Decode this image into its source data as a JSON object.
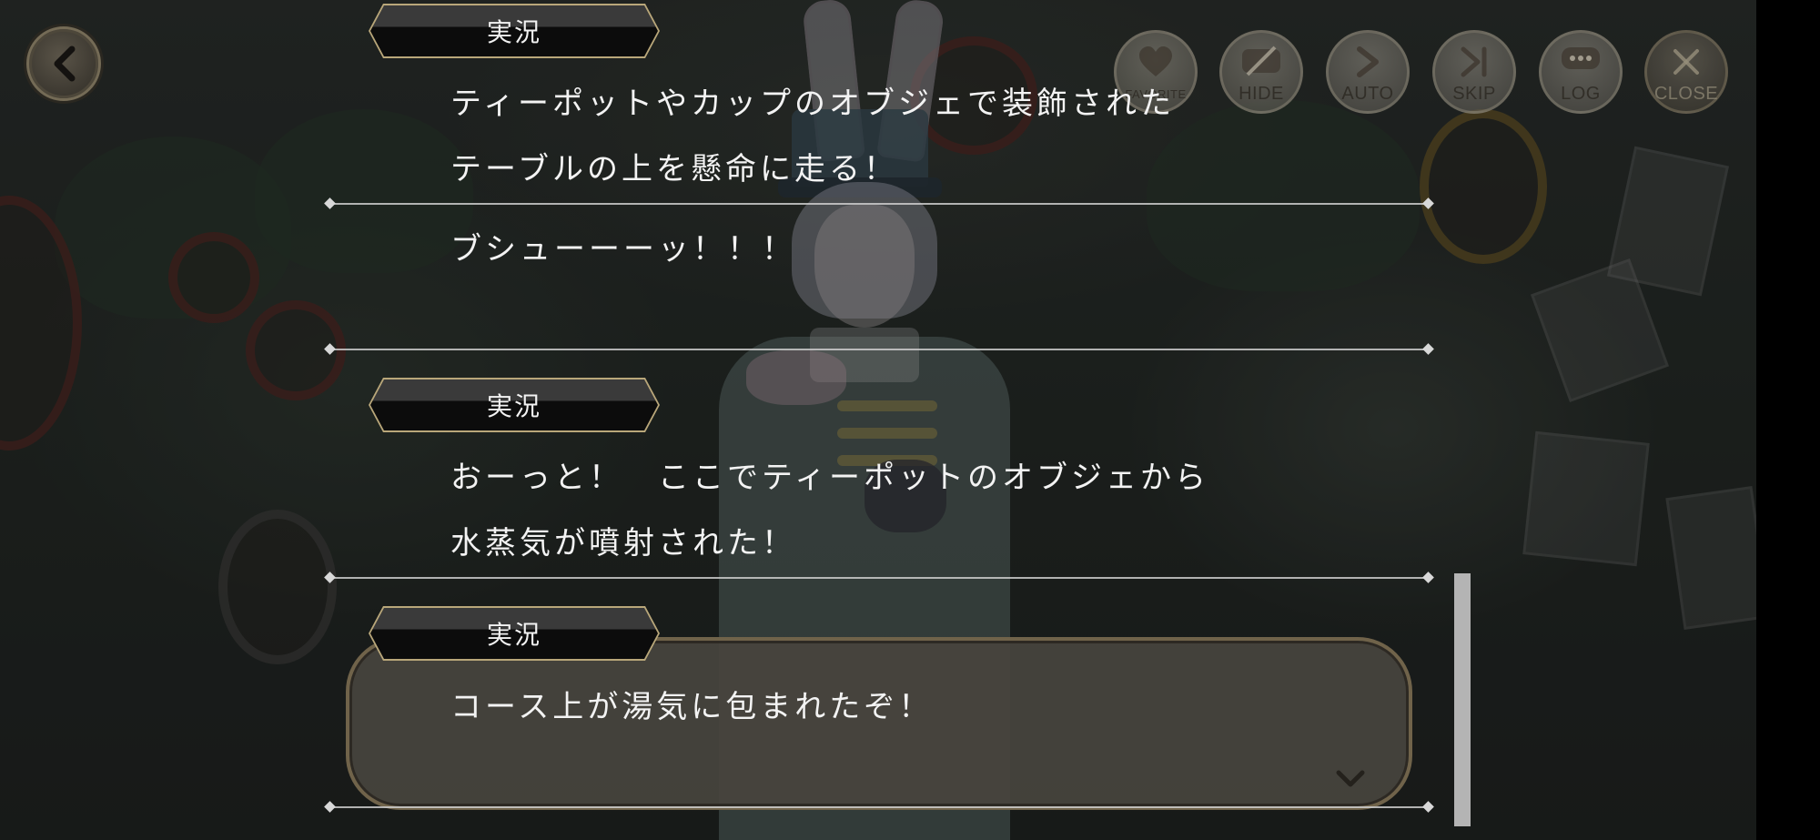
{
  "controls": {
    "favorite": "FAVORITE",
    "hide": "HIDE",
    "auto": "AUTO",
    "skip": "SKIP",
    "log": "LOG",
    "close": "CLOSE"
  },
  "icons": {
    "back": "chevron-left-icon",
    "favorite": "heart-icon",
    "hide": "eye-slash-icon",
    "auto": "play-icon",
    "skip": "skip-forward-icon",
    "log": "chat-bubble-icon",
    "close": "close-icon",
    "next": "chevron-down-icon"
  },
  "log": {
    "entries": [
      {
        "speaker": "実況",
        "lines": [
          "ティーポットやカップのオブジェで装飾された",
          "テーブルの上を懸命に走る！"
        ]
      },
      {
        "speaker": "",
        "lines": [
          "ブシューーーッ！！！"
        ]
      },
      {
        "speaker": "実況",
        "lines": [
          "おーっと！　ここでティーポットのオブジェから",
          "水蒸気が噴射された！"
        ]
      },
      {
        "speaker": "実況",
        "lines": [
          "コース上が湯気に包まれたぞ！"
        ]
      }
    ]
  },
  "colors": {
    "tag_border": "#b9a77a",
    "text": "#f3f3f3",
    "separator": "#cdcdcd",
    "scrollbar": "#b4b4b4"
  },
  "scroll": {
    "position_fraction": 1.0
  }
}
